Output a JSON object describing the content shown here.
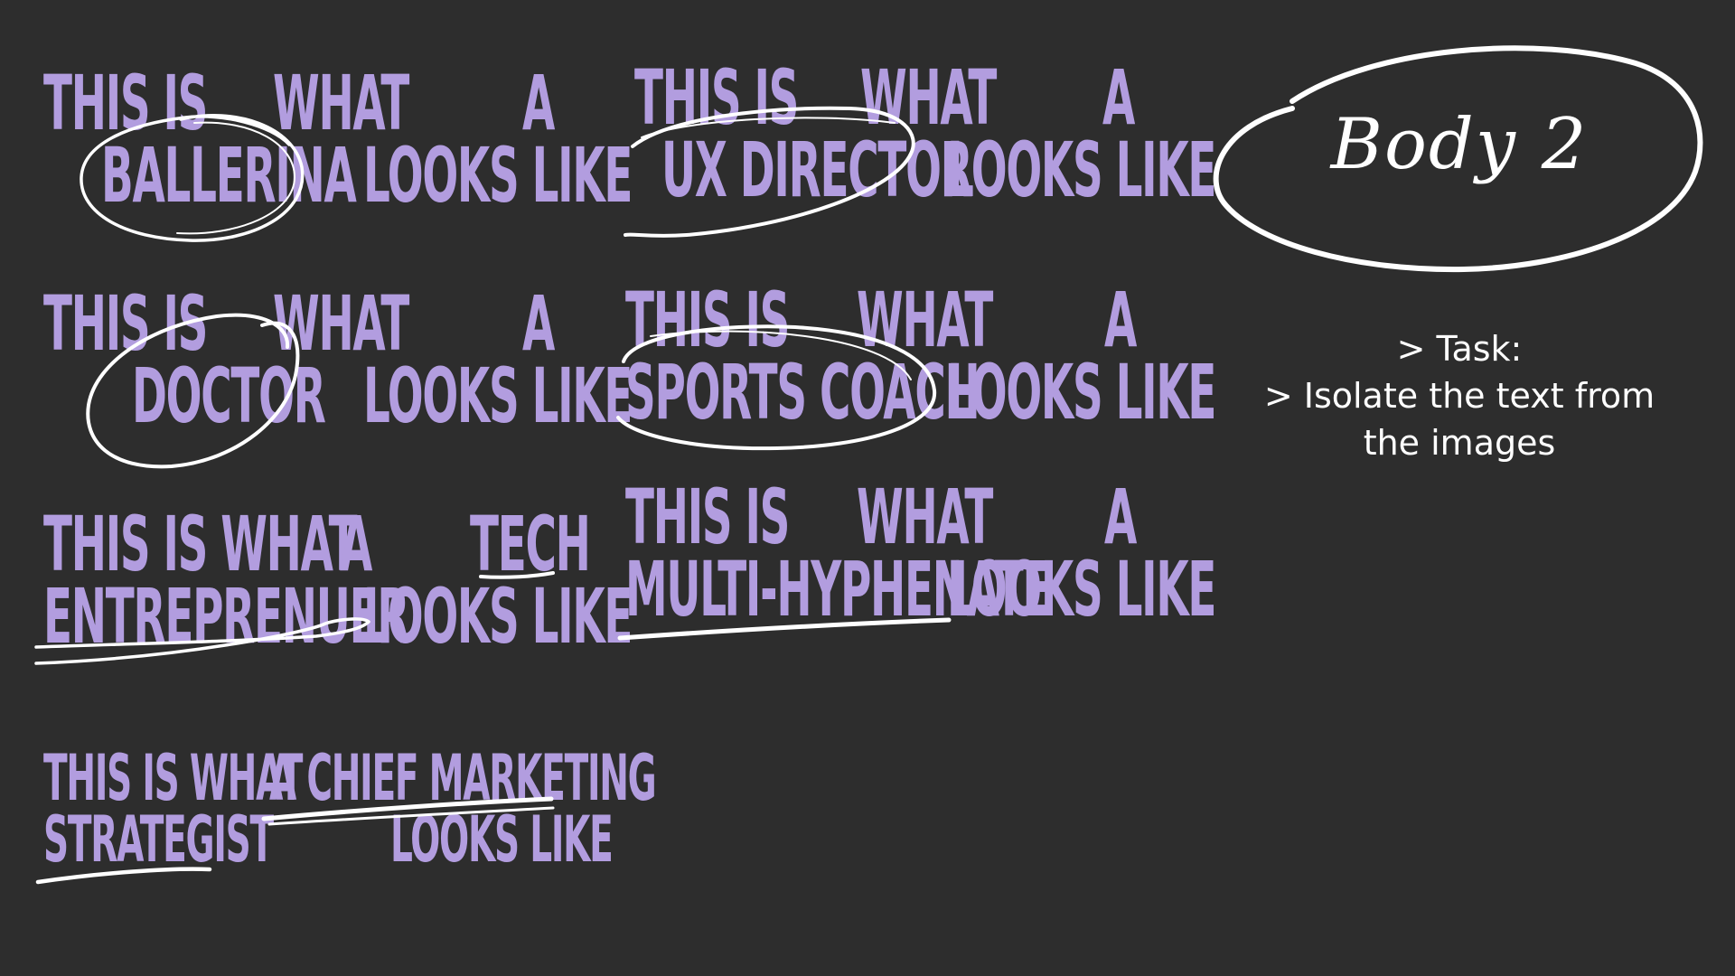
{
  "posters": [
    {
      "l1a": "THIS IS",
      "l1b": "WHAT",
      "l1c": "A",
      "l2a": "BALLERINA",
      "l2b": "LOOKS LIKE"
    },
    {
      "l1a": "THIS IS",
      "l1b": "WHAT",
      "l1c": "A",
      "l2a": "UX DIRECTOR",
      "l2b": "LOOKS LIKE"
    },
    {
      "l1a": "THIS IS",
      "l1b": "WHAT",
      "l1c": "A",
      "l2a": "DOCTOR",
      "l2b": "LOOKS LIKE"
    },
    {
      "l1a": "THIS IS",
      "l1b": "WHAT",
      "l1c": "A",
      "l2a": "SPORTS COACH",
      "l2b": "LOOKS LIKE"
    },
    {
      "l1a": "THIS IS WHAT",
      "l1b": "A",
      "l1c": "TECH",
      "l2a": "ENTREPRENUER",
      "l2b": "LOOKS LIKE"
    },
    {
      "l1a": "THIS IS",
      "l1b": "WHAT",
      "l1c": "A",
      "l2a": "MULTI-HYPHENATE",
      "l2b": "LOOKS LIKE"
    },
    {
      "l1a": "THIS IS WHAT",
      "l1b": "A CHIEF MARKETING",
      "l2a": "STRATEGIST",
      "l2b": "LOOKS LIKE"
    }
  ],
  "label": {
    "title": "Body 2",
    "task_line1": "> Task:",
    "task_line2": "> Isolate the text from",
    "task_line3": "the images"
  },
  "colors": {
    "background": "#2d2d2d",
    "poster_text": "#b29ddf",
    "annotation": "#ffffff"
  }
}
